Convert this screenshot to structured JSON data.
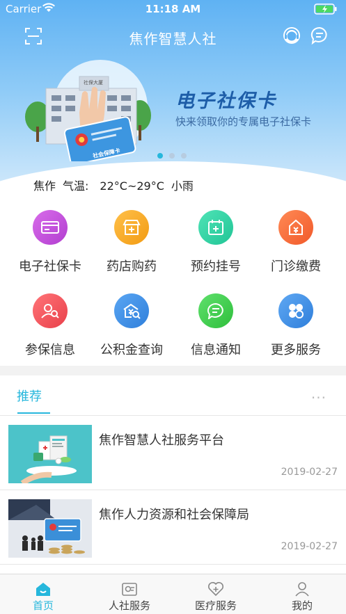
{
  "status_bar": {
    "carrier": "Carrier",
    "time": "11:18 AM"
  },
  "nav": {
    "title": "焦作智慧人社",
    "left_icon": "scan-icon",
    "right_icons": [
      "customer-service-icon",
      "message-icon"
    ]
  },
  "banner": {
    "title": "电子社保卡",
    "subtitle": "快来领取你的专属电子社保卡",
    "building_sign": "社保大厦",
    "card_text": "社会保障卡",
    "page_count": 3,
    "active_page": 1
  },
  "weather": {
    "city": "焦作",
    "label": "气温:",
    "temp": "22°C~29°C",
    "condition": "小雨"
  },
  "services": [
    {
      "label": "电子社保卡",
      "icon": "card-icon",
      "color": "#c24fdc"
    },
    {
      "label": "药店购药",
      "icon": "pharmacy-icon",
      "color": "#f6a21c"
    },
    {
      "label": "预约挂号",
      "icon": "appointment-icon",
      "color": "#2ed3a8"
    },
    {
      "label": "门诊缴费",
      "icon": "payment-icon",
      "color": "#f86a3c"
    },
    {
      "label": "参保信息",
      "icon": "insurance-info-icon",
      "color": "#f04f55"
    },
    {
      "label": "公积金查询",
      "icon": "fund-search-icon",
      "color": "#3d8ce8"
    },
    {
      "label": "信息通知",
      "icon": "notice-icon",
      "color": "#3ccf4f"
    },
    {
      "label": "更多服务",
      "icon": "more-services-icon",
      "color": "#3a8ee8"
    }
  ],
  "recommend": {
    "tab": "推荐",
    "more": "···",
    "items": [
      {
        "title": "焦作智慧人社服务平台",
        "date": "2019-02-27"
      },
      {
        "title": "焦作人力资源和社会保障局",
        "date": "2019-02-27"
      }
    ]
  },
  "tabbar": [
    {
      "label": "首页",
      "icon": "home-icon",
      "active": true
    },
    {
      "label": "人社服务",
      "icon": "social-service-icon",
      "active": false
    },
    {
      "label": "医疗服务",
      "icon": "medical-service-icon",
      "active": false
    },
    {
      "label": "我的",
      "icon": "profile-icon",
      "active": false
    }
  ],
  "colors": {
    "accent": "#26b7dc",
    "banner_title": "#1d5da8"
  }
}
